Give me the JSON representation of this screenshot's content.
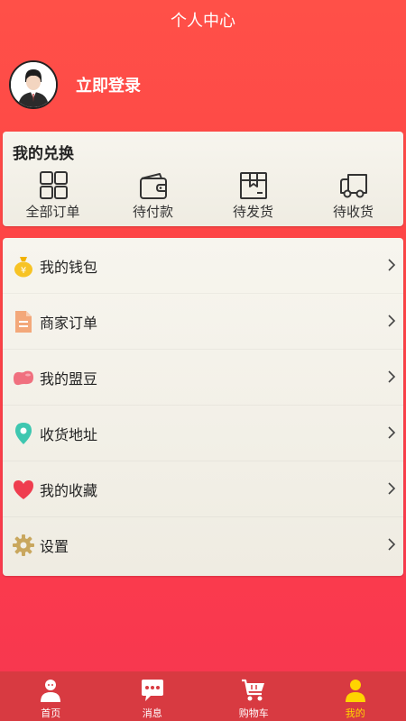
{
  "header": {
    "title": "个人中心"
  },
  "profile": {
    "login_label": "立即登录"
  },
  "exchange": {
    "title": "我的兑换",
    "items": [
      {
        "label": "全部订单",
        "icon": "grid-icon"
      },
      {
        "label": "待付款",
        "icon": "wallet-icon"
      },
      {
        "label": "待发货",
        "icon": "box-icon"
      },
      {
        "label": "待收货",
        "icon": "truck-icon"
      }
    ]
  },
  "menu": {
    "items": [
      {
        "label": "我的钱包",
        "icon": "money-bag-icon"
      },
      {
        "label": "商家订单",
        "icon": "document-icon"
      },
      {
        "label": "我的盟豆",
        "icon": "bean-icon"
      },
      {
        "label": "收货地址",
        "icon": "location-pin-icon"
      },
      {
        "label": "我的收藏",
        "icon": "heart-icon"
      },
      {
        "label": "设置",
        "icon": "gear-icon"
      }
    ]
  },
  "tabbar": {
    "items": [
      {
        "label": "首页",
        "icon": "home-person-icon",
        "active": false
      },
      {
        "label": "消息",
        "icon": "message-icon",
        "active": false
      },
      {
        "label": "购物车",
        "icon": "cart-icon",
        "active": false
      },
      {
        "label": "我的",
        "icon": "user-icon",
        "active": true
      }
    ]
  },
  "colors": {
    "accent": "#fd4446",
    "tabbar_bg": "#d83a41",
    "active_tab": "#ffd400"
  }
}
